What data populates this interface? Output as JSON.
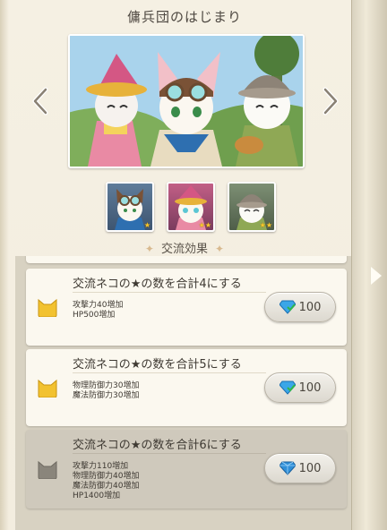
{
  "title": "傭兵団のはじまり",
  "section_label": "交流効果",
  "section_deco": "✦",
  "portraits": [
    {
      "name": "goggle-cat",
      "stars": "★"
    },
    {
      "name": "pink-hat-cat",
      "stars": "★★"
    },
    {
      "name": "helmet-cat",
      "stars": "★★"
    }
  ],
  "cards": [
    {
      "title": "交流ネコの★の数を合計4にする",
      "effects": [
        "攻撃力40増加",
        "HP500増加"
      ],
      "reward": "100",
      "state": "achieved"
    },
    {
      "title": "交流ネコの★の数を合計5にする",
      "effects": [
        "物理防御力30増加",
        "魔法防御力30増加"
      ],
      "reward": "100",
      "state": "achieved"
    },
    {
      "title": "交流ネコの★の数を合計6にする",
      "effects": [
        "攻撃力110増加",
        "物理防御力40増加",
        "魔法防御力40増加",
        "HP1400増加"
      ],
      "reward": "100",
      "state": "locked"
    }
  ],
  "colors": {
    "accent_gold": "#f2c230",
    "gem_blue": "#2f8fd8",
    "locked_bg": "#cfc9bc"
  }
}
